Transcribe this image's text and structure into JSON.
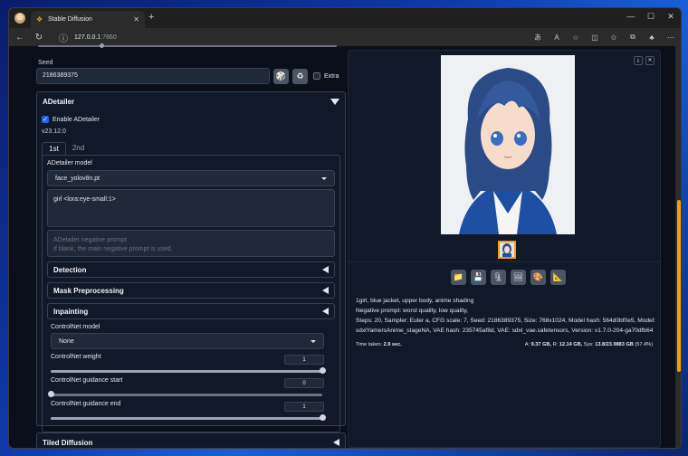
{
  "browser": {
    "tab_title": "Stable Diffusion",
    "url_host": "127.0.0.1",
    "url_port": ":7860"
  },
  "seed": {
    "label": "Seed",
    "value": "2186389375",
    "extra_label": "Extra"
  },
  "adetailer": {
    "title": "ADetailer",
    "enable_label": "Enable ADetailer",
    "enabled": true,
    "version": "v23.12.0",
    "tabs": [
      "1st",
      "2nd"
    ],
    "model_label": "ADetailer model",
    "model_value": "face_yolov8n.pt",
    "prompt_value": "girl <lora:eye-small:1>",
    "neg_placeholder_line1": "ADetailer negative prompt",
    "neg_placeholder_line2": "If blank, the main negative prompt is used.",
    "sections": [
      "Detection",
      "Mask Preprocessing",
      "Inpainting"
    ],
    "controlnet_model_label": "ControlNet model",
    "controlnet_model_value": "None",
    "controlnet_weight_label": "ControlNet weight",
    "controlnet_weight_value": "1",
    "controlnet_weight_fraction": 1.0,
    "guidance_start_label": "ControlNet guidance start",
    "guidance_start_value": "0",
    "guidance_start_fraction": 0.0,
    "guidance_end_label": "ControlNet guidance end",
    "guidance_end_value": "1",
    "guidance_end_fraction": 1.0
  },
  "tiled_diffusion": {
    "title": "Tiled Diffusion"
  },
  "output": {
    "prompt_line": "1girl, blue jacket, upper body, anime shading",
    "negative_line": "Negative prompt: worst quality, low quality,",
    "params_line1": "Steps: 20, Sampler: Euler a, CFG scale: 7, Seed: 2186389375, Size: 768x1024, Model hash: 564d0bf0e5, Model:",
    "params_line2": "sdxlYamersAnime_stageNA, VAE hash: 235745af8d, VAE: sdxl_vae.safetensors, Version: v1.7.0-204-ga70dfb64",
    "time_label": "Time taken:",
    "time_value": "2.9 sec.",
    "mem_a_label": "A:",
    "mem_a_value": "9.37 GB,",
    "mem_r_label": "R:",
    "mem_r_value": "12.14 GB,",
    "mem_sys_label": "Sys:",
    "mem_sys_value": "13.8/23.9883 GB",
    "mem_pct": "(57.4%)"
  },
  "colors": {
    "accent": "#2563eb",
    "thumb_border": "#f59e0b"
  }
}
